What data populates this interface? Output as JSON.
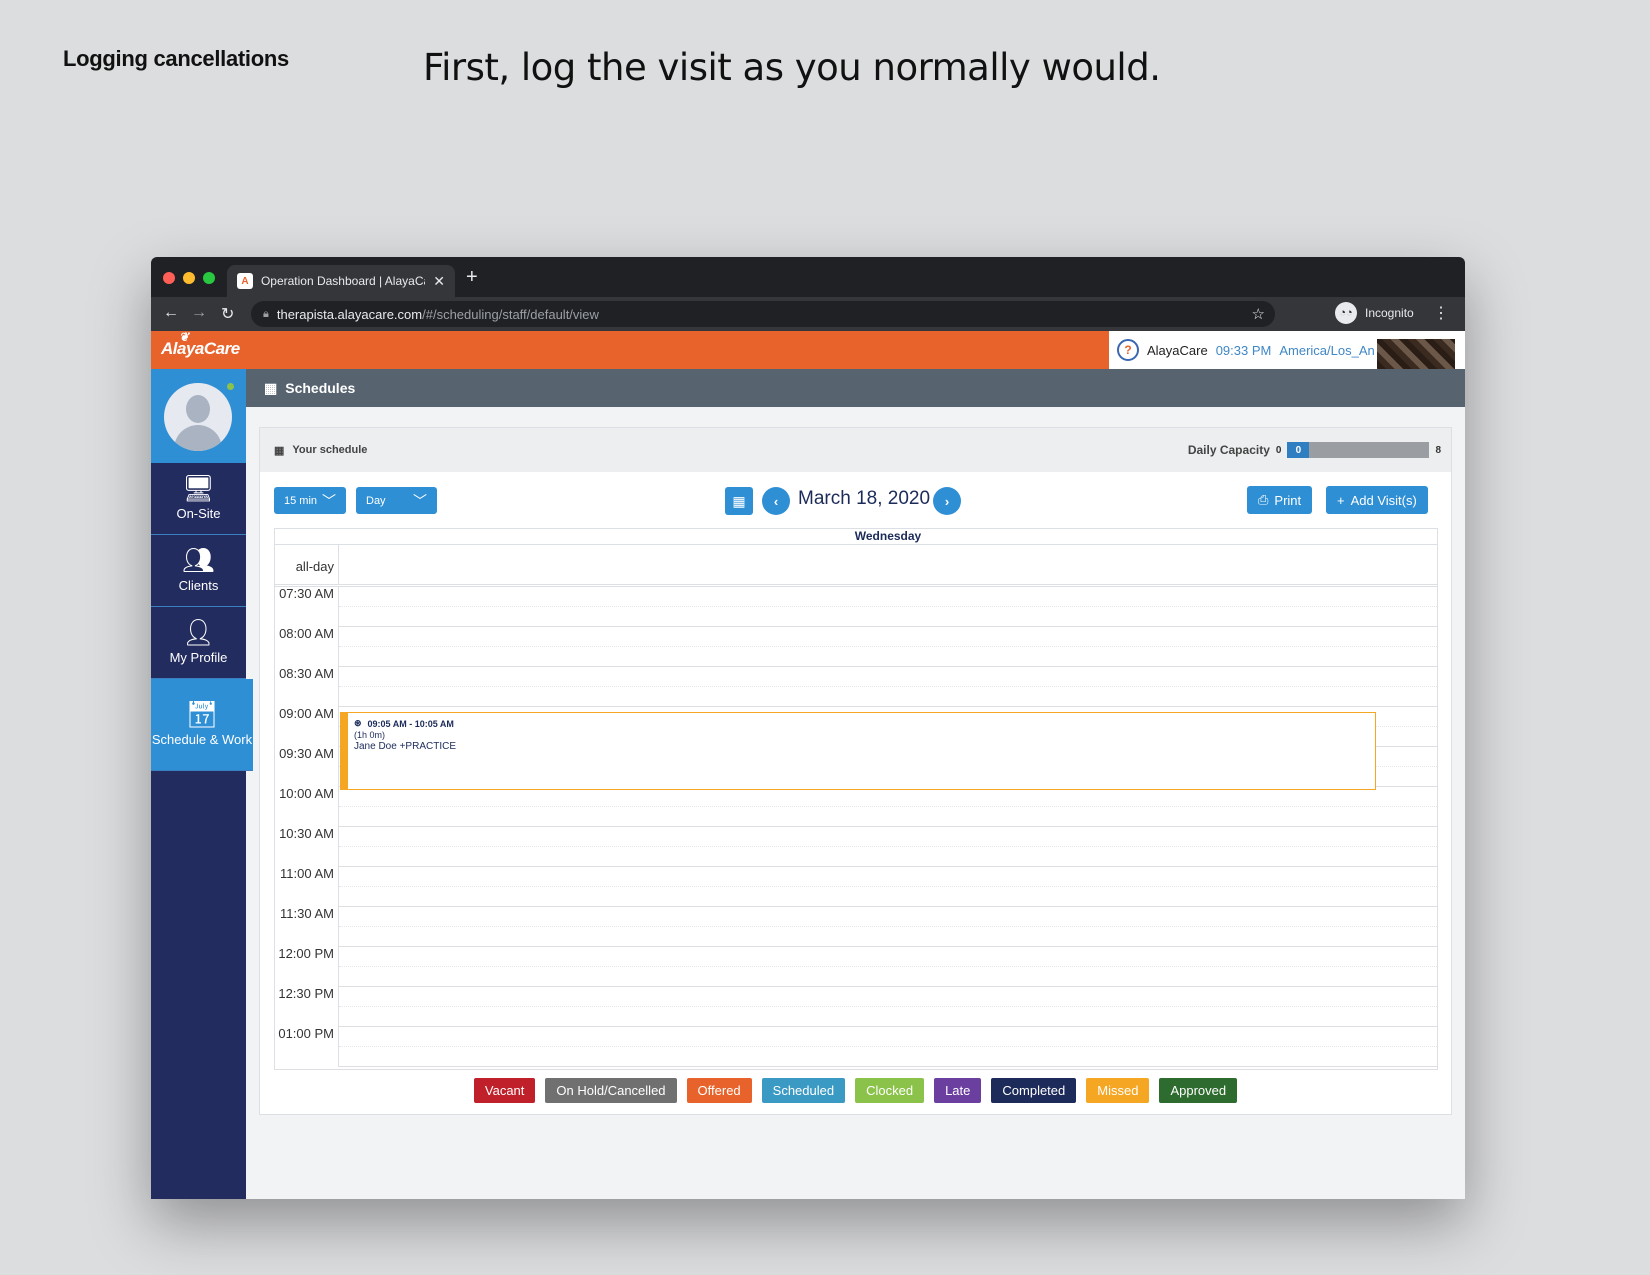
{
  "slide": {
    "heading": "Logging cancellations",
    "caption": "First, log the visit as you normally would."
  },
  "browser": {
    "tab_title": "Operation Dashboard | AlayaCare",
    "tab_favicon": "A",
    "url_host": "therapista.alayacare.com",
    "url_path": "/#/scheduling/staff/default/view",
    "incognito_label": "Incognito"
  },
  "app_header": {
    "logo": "AlayaCare",
    "org_name": "AlayaCare",
    "time": "09:33 PM",
    "timezone": "America/Los_Angeles"
  },
  "sidebar": {
    "items": [
      {
        "label": "On-Site",
        "icon": "monitor-icon"
      },
      {
        "label": "Clients",
        "icon": "clients-icon"
      },
      {
        "label": "My Profile",
        "icon": "profile-icon"
      },
      {
        "label": "Schedule & Work",
        "icon": "calendar-icon"
      }
    ]
  },
  "content": {
    "header_title": "Schedules",
    "panel_title": "Your schedule",
    "capacity_label": "Daily Capacity",
    "capacity_min": "0",
    "capacity_value": "0",
    "capacity_max": "8",
    "interval": "15 min",
    "view": "Day",
    "date": "March 18, 2020",
    "print_label": "Print",
    "add_label": "Add Visit(s)",
    "day_name": "Wednesday",
    "allday_label": "all-day"
  },
  "times": [
    "07:30 AM",
    "08:00 AM",
    "08:30 AM",
    "09:00 AM",
    "09:30 AM",
    "10:00 AM",
    "10:30 AM",
    "11:00 AM",
    "11:30 AM",
    "12:00 PM",
    "12:30 PM",
    "01:00 PM"
  ],
  "event": {
    "time_range": "09:05 AM - 10:05 AM",
    "duration": "(1h 0m)",
    "title": "Jane Doe +PRACTICE"
  },
  "legend": [
    {
      "label": "Vacant",
      "color": "#c0202a"
    },
    {
      "label": "On Hold/Cancelled",
      "color": "#707070"
    },
    {
      "label": "Offered",
      "color": "#e8632b"
    },
    {
      "label": "Scheduled",
      "color": "#3a9ac4"
    },
    {
      "label": "Clocked",
      "color": "#8bc34a"
    },
    {
      "label": "Late",
      "color": "#6a3fa0"
    },
    {
      "label": "Completed",
      "color": "#1c2b5a"
    },
    {
      "label": "Missed",
      "color": "#f5a623"
    },
    {
      "label": "Approved",
      "color": "#2e6b2e"
    }
  ]
}
